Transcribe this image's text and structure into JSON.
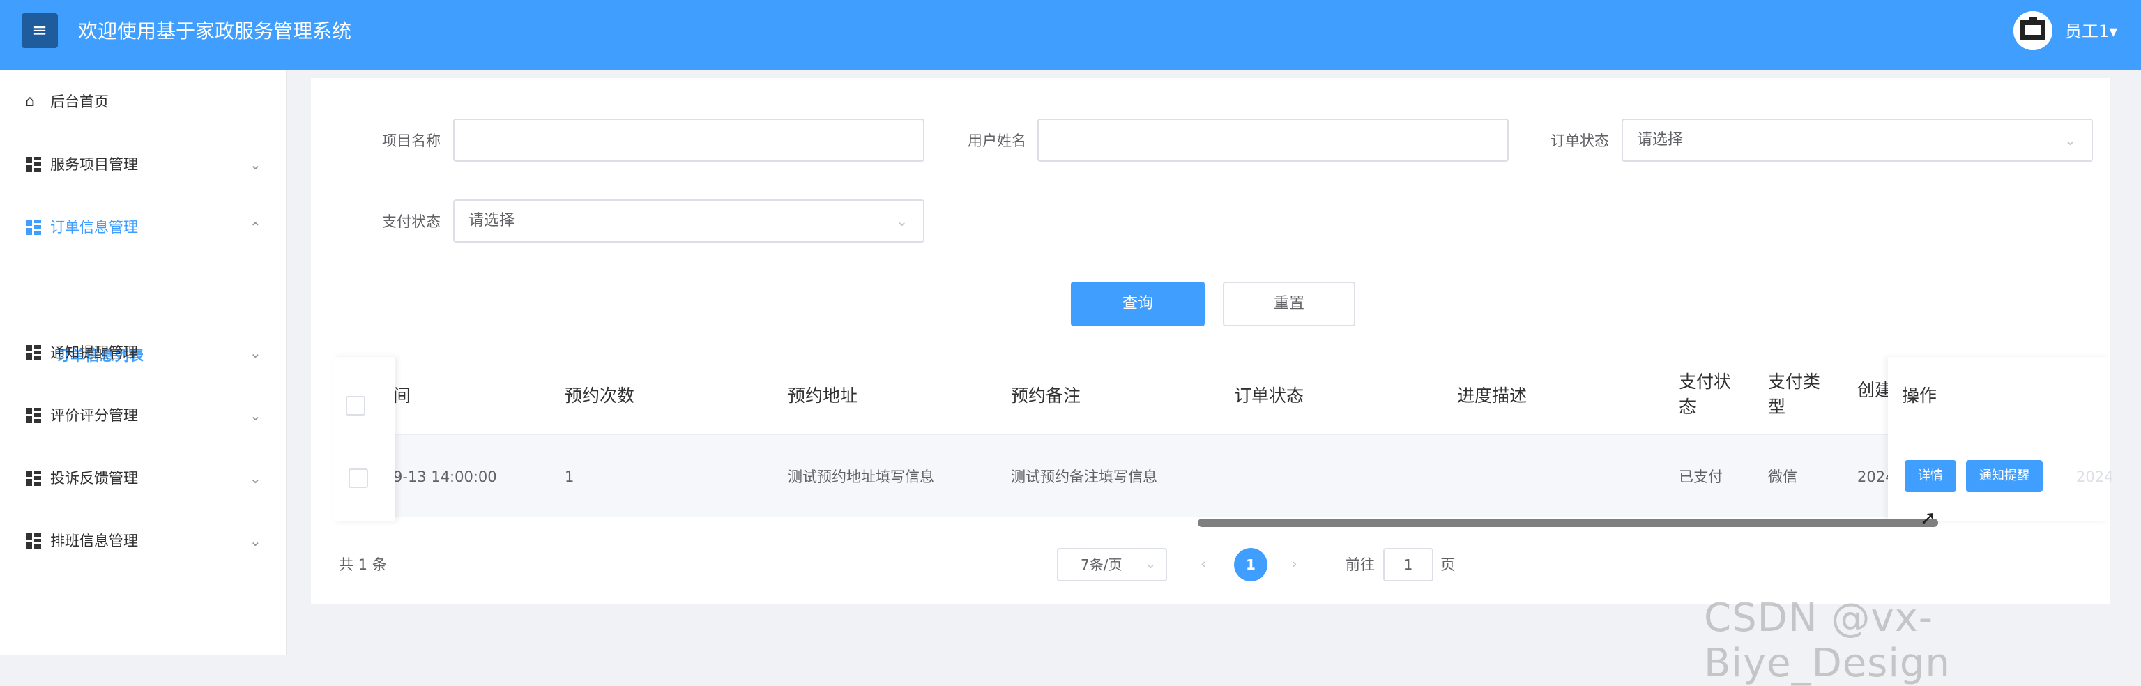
{
  "header": {
    "menu_icon": "hamburger-icon",
    "title": "欢迎使用基于家政服务管理系统",
    "user": "员工1▾"
  },
  "sidebar": {
    "items": [
      {
        "label": "后台首页",
        "icon": "home-icon",
        "chevron": ""
      },
      {
        "label": "服务项目管理",
        "icon": "grid-icon",
        "chevron": "⌄"
      },
      {
        "label": "订单信息管理",
        "icon": "grid-icon",
        "chevron": "⌃"
      },
      {
        "label": "通知提醒管理",
        "icon": "grid-icon",
        "chevron": "⌄"
      },
      {
        "label": "评价评分管理",
        "icon": "grid-icon",
        "chevron": "⌄"
      },
      {
        "label": "投诉反馈管理",
        "icon": "grid-icon",
        "chevron": "⌄"
      },
      {
        "label": "排班信息管理",
        "icon": "grid-icon",
        "chevron": "⌄"
      }
    ],
    "sub_item": "订单信息列表",
    "active_color": "#409eff"
  },
  "filters": {
    "project_label": "项目名称",
    "project_value": "",
    "user_label": "用户姓名",
    "user_value": "",
    "order_status_label": "订单状态",
    "order_status_placeholder": "请选择",
    "pay_status_label": "支付状态",
    "pay_status_placeholder": "请选择",
    "query_button": "查询",
    "reset_button": "重置"
  },
  "table": {
    "headers": {
      "time": "间",
      "count": "预约次数",
      "address": "预约地址",
      "remark": "预约备注",
      "order_status": "订单状态",
      "progress": "进度描述",
      "pay_status_1": "支付状",
      "pay_status_2": "态",
      "pay_type_1": "支付类",
      "pay_type_2": "型",
      "created": "创建",
      "actions": "操作"
    },
    "rows": [
      {
        "time": "9-13 14:00:00",
        "count": "1",
        "address": "测试预约地址填写信息",
        "remark": "测试预约备注填写信息",
        "order_status": "",
        "progress": "",
        "pay_status": "已支付",
        "pay_type": "微信",
        "created": "2024",
        "overflow": "2024",
        "detail_button": "详情",
        "notify_button": "通知提醒"
      }
    ]
  },
  "pagination": {
    "total": "共 1 条",
    "page_size": "7条/页",
    "prev": "‹",
    "current": "1",
    "next": "›",
    "goto_prefix": "前往",
    "goto_value": "1",
    "goto_suffix": "页"
  },
  "watermark": "CSDN @vx-Biye_Design",
  "colors": {
    "primary": "#409eff",
    "header_bg": "#409eff"
  }
}
